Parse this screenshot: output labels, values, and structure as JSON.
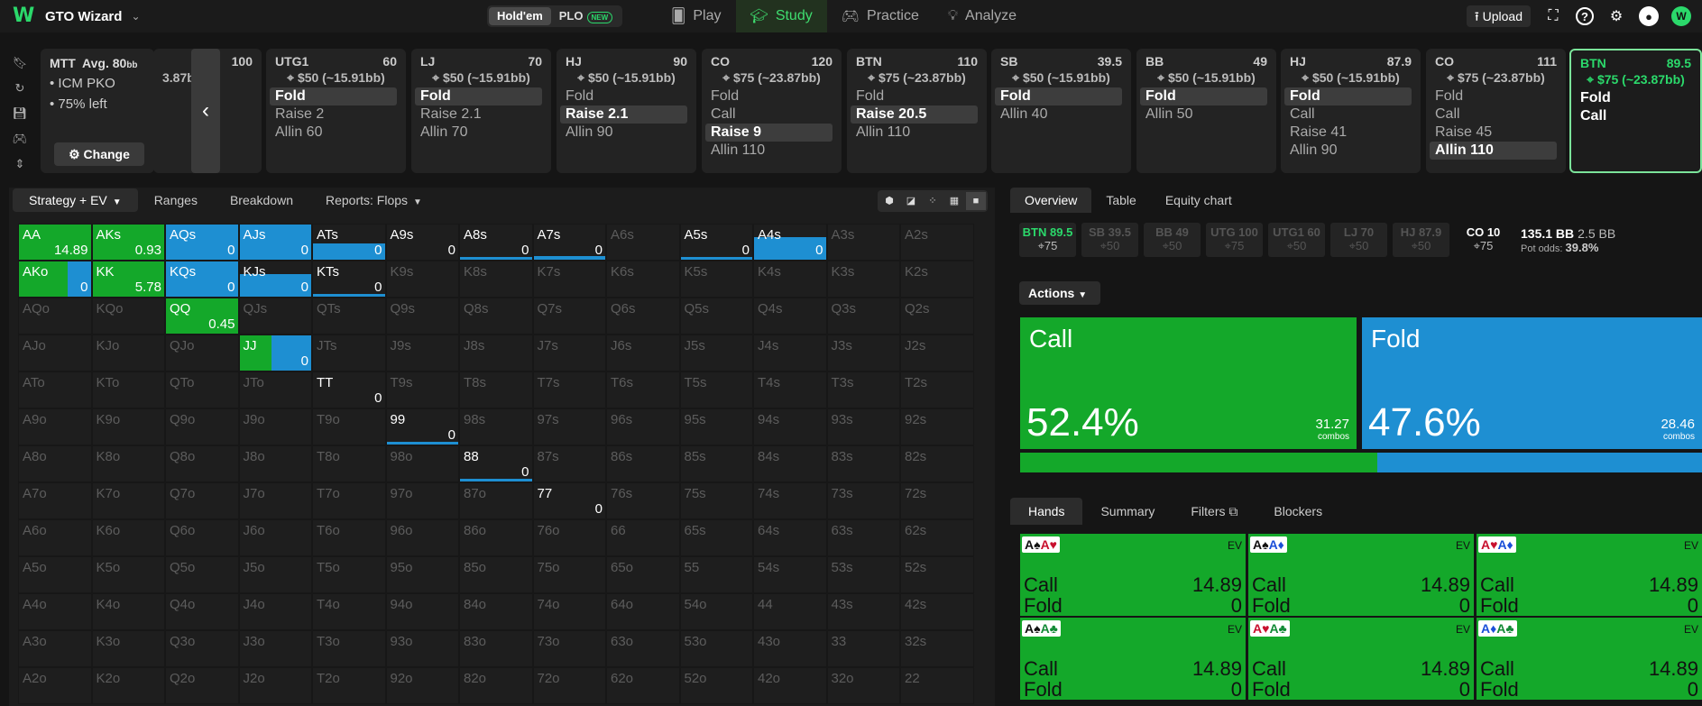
{
  "app": {
    "name": "GTO Wizard"
  },
  "game_toggle": [
    {
      "label": "Hold'em",
      "active": true
    },
    {
      "label": "PLO",
      "badge": "NEW",
      "active": false
    }
  ],
  "nav": [
    {
      "label": "Play",
      "icon": "cards-icon",
      "active": false
    },
    {
      "label": "Study",
      "icon": "graduation-cap-icon",
      "active": true
    },
    {
      "label": "Practice",
      "icon": "gamepad-icon",
      "active": false
    },
    {
      "label": "Analyze",
      "icon": "lightbulb-icon",
      "active": false
    }
  ],
  "header_right": {
    "upload_label": "Upload",
    "avatar_letter": "W"
  },
  "mtt": {
    "type": "MTT",
    "avg_label": "Avg. 80",
    "avg_unit": "bb",
    "lines": [
      "ICM PKO",
      "75% left"
    ],
    "change_label": "Change"
  },
  "players": [
    {
      "pos": "",
      "stack": "100",
      "bounty": "3.87bb)",
      "actions": [],
      "partial": true
    },
    {
      "pos": "UTG1",
      "stack": "60",
      "bounty": "$50 (~15.91bb)",
      "actions": [
        {
          "label": "Fold",
          "sel": true
        },
        {
          "label": "Raise 2"
        },
        {
          "label": "Allin 60"
        }
      ]
    },
    {
      "pos": "LJ",
      "stack": "70",
      "bounty": "$50 (~15.91bb)",
      "actions": [
        {
          "label": "Fold",
          "sel": true
        },
        {
          "label": "Raise 2.1"
        },
        {
          "label": "Allin 70"
        }
      ]
    },
    {
      "pos": "HJ",
      "stack": "90",
      "bounty": "$50 (~15.91bb)",
      "actions": [
        {
          "label": "Fold"
        },
        {
          "label": "Raise 2.1",
          "sel": true
        },
        {
          "label": "Allin 90"
        }
      ]
    },
    {
      "pos": "CO",
      "stack": "120",
      "bounty": "$75 (~23.87bb)",
      "actions": [
        {
          "label": "Fold"
        },
        {
          "label": "Call"
        },
        {
          "label": "Raise 9",
          "sel": true
        },
        {
          "label": "Allin 110"
        }
      ]
    },
    {
      "pos": "BTN",
      "stack": "110",
      "bounty": "$75 (~23.87bb)",
      "actions": [
        {
          "label": "Fold"
        },
        {
          "label": "Raise 20.5",
          "sel": true
        },
        {
          "label": "Allin 110"
        }
      ]
    },
    {
      "pos": "SB",
      "stack": "39.5",
      "bounty": "$50 (~15.91bb)",
      "actions": [
        {
          "label": "Fold",
          "sel": true
        },
        {
          "label": "Allin 40"
        }
      ]
    },
    {
      "pos": "BB",
      "stack": "49",
      "bounty": "$50 (~15.91bb)",
      "actions": [
        {
          "label": "Fold",
          "sel": true
        },
        {
          "label": "Allin 50"
        }
      ]
    },
    {
      "pos": "HJ",
      "stack": "87.9",
      "bounty": "$50 (~15.91bb)",
      "actions": [
        {
          "label": "Fold",
          "sel": true
        },
        {
          "label": "Call"
        },
        {
          "label": "Raise 41"
        },
        {
          "label": "Allin 90"
        }
      ]
    },
    {
      "pos": "CO",
      "stack": "111",
      "bounty": "$75 (~23.87bb)",
      "actions": [
        {
          "label": "Fold"
        },
        {
          "label": "Call"
        },
        {
          "label": "Raise 45"
        },
        {
          "label": "Allin 110",
          "sel": true
        }
      ]
    },
    {
      "pos": "BTN",
      "stack": "89.5",
      "bounty": "$75 (~23.87bb)",
      "actions": [
        {
          "label": "Fold"
        },
        {
          "label": "Call"
        }
      ],
      "active": true
    }
  ],
  "left_tabs": [
    {
      "label": "Strategy + EV",
      "active": true,
      "caret": true
    },
    {
      "label": "Ranges"
    },
    {
      "label": "Breakdown"
    },
    {
      "label": "Reports: Flops",
      "caret": true
    }
  ],
  "grid_ranks": [
    "A",
    "K",
    "Q",
    "J",
    "T",
    "9",
    "8",
    "7",
    "6",
    "5",
    "4",
    "3",
    "2"
  ],
  "live_hands": {
    "AA": {
      "val": "14.89",
      "g": 1.0,
      "b": 0
    },
    "AKs": {
      "val": "0.93",
      "g": 1.0,
      "b": 0
    },
    "AQs": {
      "val": "0",
      "g": 0,
      "b": 1.0
    },
    "AJs": {
      "val": "0",
      "g": 0,
      "b": 1.0
    },
    "ATs": {
      "val": "0",
      "g": 0,
      "b": 1.0,
      "partial": 0.45
    },
    "A9s": {
      "val": "0",
      "g": 0,
      "b": 0
    },
    "A8s": {
      "val": "0",
      "g": 0,
      "b": 0,
      "bar": 1.0
    },
    "A7s": {
      "val": "0",
      "g": 0,
      "b": 0,
      "bar": 1.0,
      "barThick": true
    },
    "A5s": {
      "val": "0",
      "g": 0,
      "b": 0,
      "bar": 1.0
    },
    "A4s": {
      "val": "0",
      "g": 0,
      "b": 1.0,
      "partial": 0.65
    },
    "AKo": {
      "val": "0",
      "g": 0.68,
      "b": 0.32
    },
    "KK": {
      "val": "5.78",
      "g": 1.0,
      "b": 0
    },
    "KQs": {
      "val": "0",
      "g": 0,
      "b": 1.0
    },
    "KJs": {
      "val": "0",
      "g": 0,
      "b": 1.0,
      "partial": 0.65
    },
    "KTs": {
      "val": "0",
      "g": 0,
      "b": 0,
      "bar": 1.0
    },
    "QQ": {
      "val": "0.45",
      "g": 1.0,
      "b": 0
    },
    "JJ": {
      "val": "0",
      "g": 0.45,
      "b": 0.55
    },
    "TT": {
      "val": "0",
      "g": 0,
      "b": 0
    },
    "99": {
      "val": "0",
      "g": 0,
      "b": 0,
      "bar": 1.0
    },
    "88": {
      "val": "0",
      "g": 0,
      "b": 0,
      "bar": 1.0
    },
    "77": {
      "val": "0",
      "g": 0,
      "b": 0
    }
  },
  "right_tabs": [
    {
      "label": "Overview",
      "active": true
    },
    {
      "label": "Table"
    },
    {
      "label": "Equity chart"
    }
  ],
  "positions": [
    {
      "pos": "BTN 89.5",
      "b": "75",
      "hl": true
    },
    {
      "pos": "SB 39.5",
      "b": "50"
    },
    {
      "pos": "BB 49",
      "b": "50"
    },
    {
      "pos": "UTG 100",
      "b": "75"
    },
    {
      "pos": "UTG1 60",
      "b": "50"
    },
    {
      "pos": "LJ 70",
      "b": "50"
    },
    {
      "pos": "HJ 87.9",
      "b": "50"
    },
    {
      "pos": "CO 10",
      "b": "75",
      "co": true
    }
  ],
  "pot": {
    "total": "135.1 BB",
    "bb": "2.5 BB",
    "odds_label": "Pot odds:",
    "odds": "39.8%"
  },
  "actions_label": "Actions",
  "summary": [
    {
      "name": "Call",
      "pct": "52.4%",
      "combos": "31.27",
      "combos_label": "combos"
    },
    {
      "name": "Fold",
      "pct": "47.6%",
      "combos": "28.46",
      "combos_label": "combos"
    }
  ],
  "freq": {
    "call": 0.524,
    "fold": 0.476,
    "colors": {
      "call": "#14a82a",
      "fold": "#1e8fd2"
    }
  },
  "hand_tabs": [
    {
      "label": "Hands",
      "active": true
    },
    {
      "label": "Summary"
    },
    {
      "label": "Filters"
    },
    {
      "label": "Blockers"
    }
  ],
  "hand_cards": [
    {
      "c1": "A♠",
      "c1c": "blk",
      "c2": "A♥",
      "c2c": "red",
      "ev": "EV",
      "call": "14.89",
      "fold": "0"
    },
    {
      "c1": "A♠",
      "c1c": "blk",
      "c2": "A♦",
      "c2c": "blu",
      "ev": "EV",
      "call": "14.89",
      "fold": "0"
    },
    {
      "c1": "A♥",
      "c1c": "red",
      "c2": "A♦",
      "c2c": "blu",
      "ev": "EV",
      "call": "14.89",
      "fold": "0"
    },
    {
      "c1": "A♠",
      "c1c": "blk",
      "c2": "A♣",
      "c2c": "grn",
      "ev": "EV",
      "call": "14.89",
      "fold": "0"
    },
    {
      "c1": "A♥",
      "c1c": "red",
      "c2": "A♣",
      "c2c": "grn",
      "ev": "EV",
      "call": "14.89",
      "fold": "0"
    },
    {
      "c1": "A♦",
      "c1c": "blu",
      "c2": "A♣",
      "c2c": "grn",
      "ev": "EV",
      "call": "14.89",
      "fold": "0"
    }
  ],
  "hand_labels": {
    "call": "Call",
    "fold": "Fold"
  }
}
